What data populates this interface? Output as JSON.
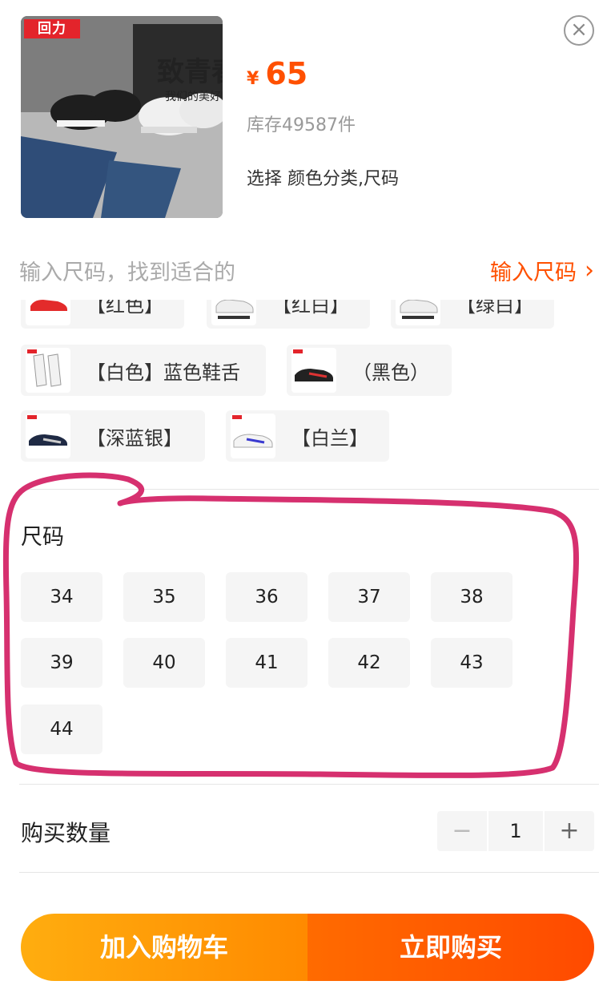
{
  "product": {
    "brand_logo": "回力",
    "slogan_main": "致青春",
    "slogan_sub": "我们的美好时光",
    "currency": "¥",
    "price": "65",
    "stock": "库存49587件",
    "selection_hint": "选择 颜色分类,尺码"
  },
  "close_icon": "close-circle-icon",
  "size_finder": {
    "label": "输入尺码，找到适合的",
    "link": "输入尺码",
    "link_icon": "chevron-right-icon"
  },
  "colors": [
    {
      "label": "【红色】",
      "shoe": "red"
    },
    {
      "label": "【红白】",
      "shoe": "white"
    },
    {
      "label": "【绿白】",
      "shoe": "white"
    },
    {
      "label": "【白色】蓝色鞋舌",
      "shoe": "white"
    },
    {
      "label": "（黑色）",
      "shoe": "black"
    },
    {
      "label": "【深蓝银】",
      "shoe": "navy"
    },
    {
      "label": "【白兰】",
      "shoe": "white-blue"
    }
  ],
  "size_section": {
    "title": "尺码",
    "sizes": [
      "34",
      "35",
      "36",
      "37",
      "38",
      "39",
      "40",
      "41",
      "42",
      "43",
      "44"
    ]
  },
  "quantity": {
    "label": "购买数量",
    "minus": "−",
    "value": "1",
    "plus": "+"
  },
  "actions": {
    "add_to_cart": "加入购物车",
    "buy_now": "立即购买"
  },
  "colors_theme": {
    "accent": "#ff5000",
    "annotation": "#d6306f"
  }
}
